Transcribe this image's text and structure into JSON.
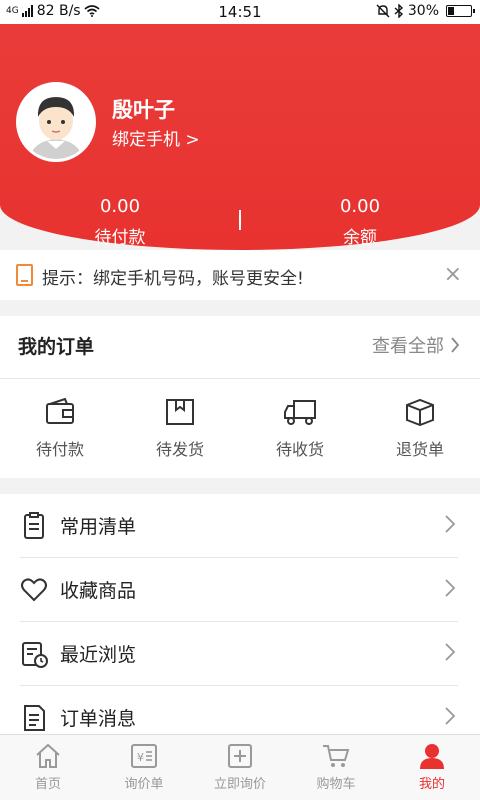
{
  "status_bar": {
    "network": "4G",
    "speed": "82 B/s",
    "time": "14:51",
    "battery": "30%",
    "battery_level": 0.3
  },
  "profile": {
    "name": "殷叶子",
    "bind_phone": "绑定手机 >"
  },
  "stats": [
    {
      "value": "0.00",
      "label": "待付款"
    },
    {
      "value": "0.00",
      "label": "余额"
    }
  ],
  "tip": {
    "text": "提示：绑定手机号码，账号更安全!",
    "close": "×"
  },
  "orders": {
    "title": "我的订单",
    "view_all": "查看全部",
    "items": [
      {
        "label": "待付款",
        "icon": "wallet-icon"
      },
      {
        "label": "待发货",
        "icon": "package-icon"
      },
      {
        "label": "待收货",
        "icon": "truck-icon"
      },
      {
        "label": "退货单",
        "icon": "box-icon"
      }
    ]
  },
  "menu": [
    {
      "label": "常用清单",
      "icon": "clipboard-icon"
    },
    {
      "label": "收藏商品",
      "icon": "heart-icon"
    },
    {
      "label": "最近浏览",
      "icon": "history-icon"
    },
    {
      "label": "订单消息",
      "icon": "document-icon"
    }
  ],
  "tabbar": [
    {
      "label": "首页",
      "icon": "home-icon"
    },
    {
      "label": "询价单",
      "icon": "price-icon"
    },
    {
      "label": "立即询价",
      "icon": "plus-square-icon"
    },
    {
      "label": "购物车",
      "icon": "cart-icon"
    },
    {
      "label": "我的",
      "icon": "user-icon",
      "active": true
    }
  ],
  "colors": {
    "brand_red": "#e8322f",
    "tip_orange": "#f08a3a"
  }
}
